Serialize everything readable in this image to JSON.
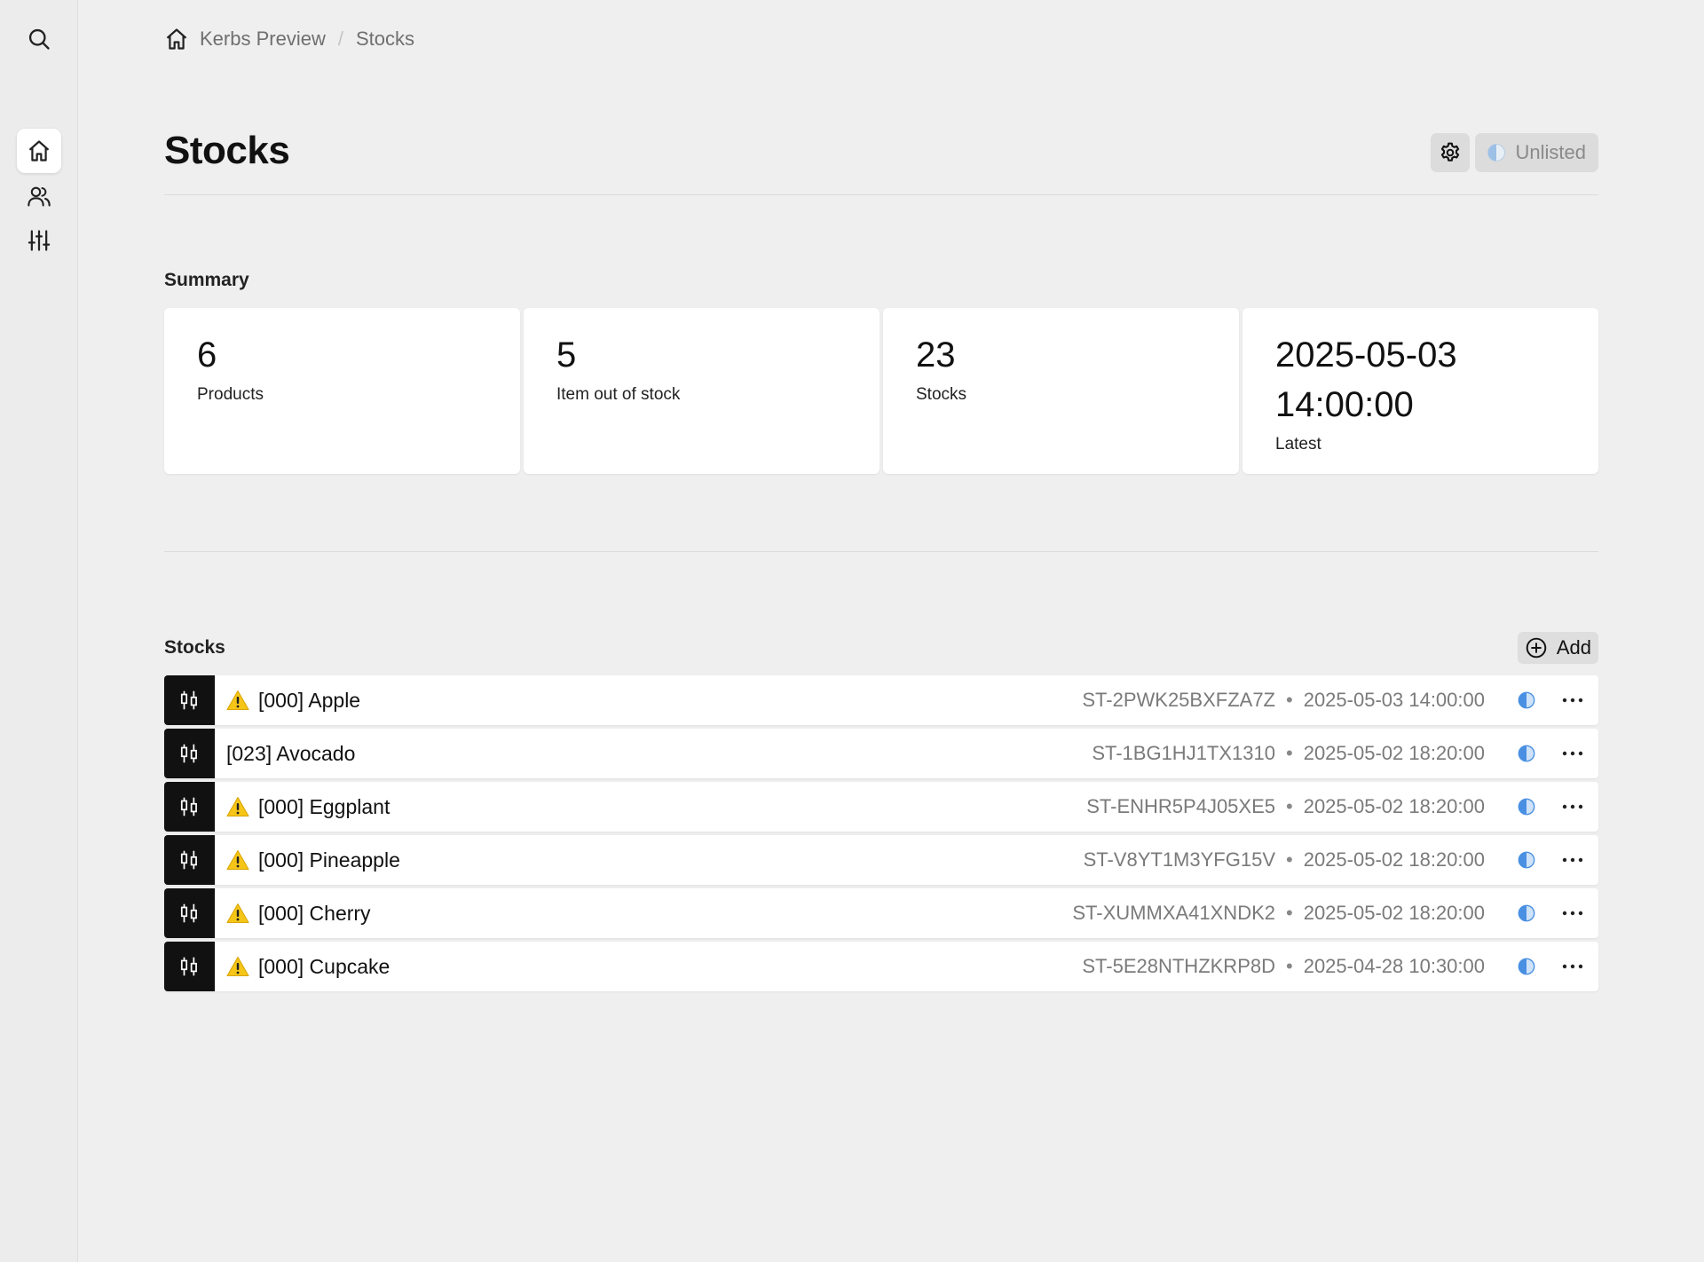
{
  "breadcrumb": {
    "workspace": "Kerbs Preview",
    "current": "Stocks",
    "separator": "/"
  },
  "page": {
    "title": "Stocks",
    "visibility_label": "Unlisted"
  },
  "summary": {
    "heading": "Summary",
    "cards": [
      {
        "value": "6",
        "caption": "Products"
      },
      {
        "value": "5",
        "caption": "Item out of stock"
      },
      {
        "value": "23",
        "caption": "Stocks"
      },
      {
        "value": "2025-05-03 14:00:00",
        "caption": "Latest"
      }
    ]
  },
  "stocks": {
    "heading": "Stocks",
    "add_label": "Add",
    "rows": [
      {
        "name": "[000] Apple",
        "warning": true,
        "code": "ST-2PWK25BXFZA7Z",
        "timestamp": "2025-05-03 14:00:00"
      },
      {
        "name": "[023] Avocado",
        "warning": false,
        "code": "ST-1BG1HJ1TX1310",
        "timestamp": "2025-05-02 18:20:00"
      },
      {
        "name": "[000] Eggplant",
        "warning": true,
        "code": "ST-ENHR5P4J05XE5",
        "timestamp": "2025-05-02 18:20:00"
      },
      {
        "name": "[000] Pineapple",
        "warning": true,
        "code": "ST-V8YT1M3YFG15V",
        "timestamp": "2025-05-02 18:20:00"
      },
      {
        "name": "[000] Cherry",
        "warning": true,
        "code": "ST-XUMMXA41XNDK2",
        "timestamp": "2025-05-02 18:20:00"
      },
      {
        "name": "[000] Cupcake",
        "warning": true,
        "code": "ST-5E28NTHZKRP8D",
        "timestamp": "2025-04-28 10:30:00"
      }
    ]
  },
  "icons": {
    "rail": [
      "search-icon",
      "home-icon",
      "users-icon",
      "sliders-icon"
    ],
    "row_thumb": "candlestick-icon",
    "row_status": "half-circle-icon",
    "row_more": "ellipsis-icon",
    "warning": "warning-triangle-icon"
  },
  "colors": {
    "status_blue": "#4a90e2",
    "warning_yellow": "#f5c518"
  }
}
